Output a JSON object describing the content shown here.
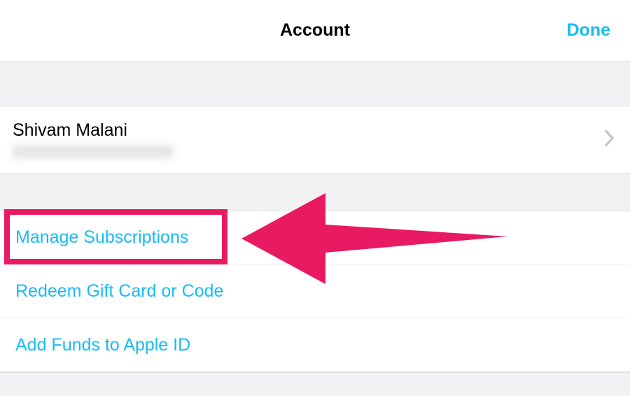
{
  "nav": {
    "title": "Account",
    "done": "Done"
  },
  "profile": {
    "name": "Shivam Malani"
  },
  "actions": {
    "manage_subs": "Manage Subscriptions",
    "redeem": "Redeem Gift Card or Code",
    "add_funds": "Add Funds to Apple ID"
  },
  "annotation": {
    "highlight_color": "#e81a62"
  }
}
